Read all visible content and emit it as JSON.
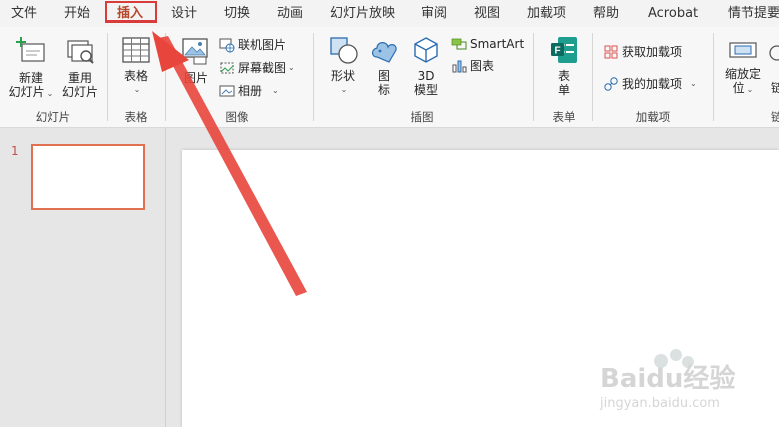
{
  "tabs": [
    "文件",
    "开始",
    "插入",
    "设计",
    "切换",
    "动画",
    "幻灯片放映",
    "审阅",
    "视图",
    "加载项",
    "帮助",
    "Acrobat",
    "情节提要"
  ],
  "active_tab": "插入",
  "ribbon": {
    "slides": {
      "new_slide": [
        "新建",
        "幻灯片"
      ],
      "reuse_slide": [
        "重用",
        "幻灯片"
      ],
      "label": "幻灯片"
    },
    "tables": {
      "table": "表格",
      "label": "表格"
    },
    "images": {
      "picture": "图片",
      "online_pictures": "联机图片",
      "screenshot": "屏幕截图",
      "album": "相册",
      "label": "图像"
    },
    "illustrations": {
      "shapes": "形状",
      "icons": [
        "图",
        "标"
      ],
      "models_3d": [
        "3D",
        "模型"
      ],
      "smartart": "SmartArt",
      "chart": "图表",
      "label": "插图"
    },
    "forms": {
      "form": [
        "表",
        "单"
      ],
      "label": "表单"
    },
    "addins": {
      "get_addins": "获取加载项",
      "my_addins": "我的加载项",
      "label": "加载项"
    },
    "zoom": {
      "zoom": [
        "缩放定",
        "位"
      ],
      "partial": "链",
      "label": "链"
    }
  },
  "slides_panel": {
    "slide_number": "1"
  },
  "colors": {
    "accent": "#b7472a",
    "highlight": "#d93a3a",
    "arrow": "#e8453c",
    "thumb_border": "#e07050"
  },
  "watermark": {
    "brand": "Baidu经验",
    "url": "jingyan.baidu.com"
  }
}
